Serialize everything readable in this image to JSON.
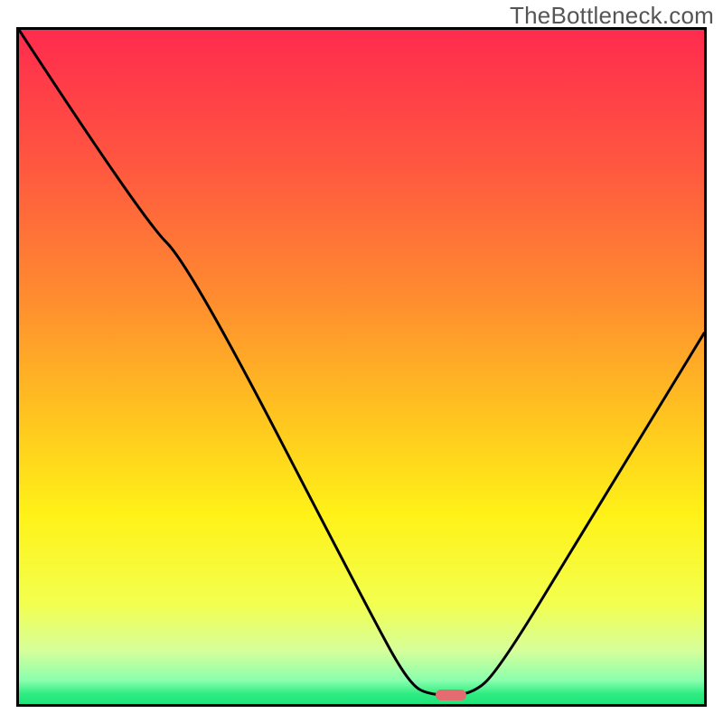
{
  "watermark": "TheBottleneck.com",
  "colors": {
    "gradient_stops": [
      {
        "pos": 0.0,
        "color": "#ff2b4e"
      },
      {
        "pos": 0.2,
        "color": "#ff5740"
      },
      {
        "pos": 0.4,
        "color": "#ff8d2f"
      },
      {
        "pos": 0.58,
        "color": "#ffc61f"
      },
      {
        "pos": 0.72,
        "color": "#fff218"
      },
      {
        "pos": 0.85,
        "color": "#f3ff4e"
      },
      {
        "pos": 0.92,
        "color": "#d7ff9a"
      },
      {
        "pos": 0.965,
        "color": "#8affad"
      },
      {
        "pos": 0.985,
        "color": "#2eec82"
      },
      {
        "pos": 1.0,
        "color": "#20e47a"
      }
    ],
    "curve": "#000000",
    "marker": "#e46b6f",
    "border": "#000000"
  },
  "marker": {
    "x_pct": 63,
    "y_pct": 98.7
  },
  "chart_data": {
    "type": "line",
    "title": "",
    "xlabel": "",
    "ylabel": "",
    "xlim": [
      0,
      100
    ],
    "ylim": [
      0,
      100
    ],
    "note": "Axes have no tick labels in the source image; x/y are in percent of plot width/height; y=0 at bottom, y=100 at top.",
    "series": [
      {
        "name": "bottleneck-curve",
        "points": [
          {
            "x": 0,
            "y": 100
          },
          {
            "x": 18,
            "y": 72
          },
          {
            "x": 25,
            "y": 65
          },
          {
            "x": 52,
            "y": 12
          },
          {
            "x": 57,
            "y": 3
          },
          {
            "x": 60,
            "y": 1.3
          },
          {
            "x": 66,
            "y": 1.3
          },
          {
            "x": 70,
            "y": 5
          },
          {
            "x": 82,
            "y": 25
          },
          {
            "x": 100,
            "y": 55
          }
        ]
      }
    ],
    "marker_point": {
      "x": 63,
      "y": 1.3
    }
  }
}
